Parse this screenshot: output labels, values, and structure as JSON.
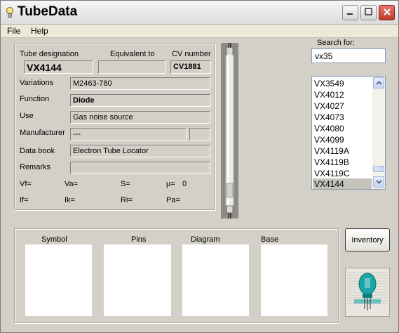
{
  "window": {
    "title": "TubeData"
  },
  "menu": {
    "file": "File",
    "help": "Help"
  },
  "details": {
    "tube_designation_label": "Tube designation",
    "tube_designation_value": "VX4144",
    "equivalent_label": "Equivalent to",
    "equivalent_value": "",
    "cv_label": "CV number",
    "cv_value": "CV1881",
    "variations_label": "Variations",
    "variations_value": "M2463-780",
    "function_label": "Function",
    "function_value": "Diode",
    "use_label": "Use",
    "use_value": "Gas noise source",
    "manufacturer_label": "Manufacturer",
    "manufacturer_value": "---",
    "manufacturer_extra": "",
    "databook_label": "Data book",
    "databook_value": "Electron Tube Locator",
    "remarks_label": "Remarks",
    "remarks_value": ""
  },
  "params": {
    "vf": "Vf=",
    "va": "Va=",
    "s": "S=",
    "mu": "µ=",
    "mu_value": "0",
    "if": "If=",
    "ik": "Ik=",
    "ri": "Ri=",
    "pa": "Pa="
  },
  "search": {
    "label": "Search for:",
    "value": "vx35"
  },
  "list": {
    "items": [
      "VX3549",
      "VX4012",
      "VX4027",
      "VX4073",
      "VX4080",
      "VX4099",
      "VX4119A",
      "VX4119B",
      "VX4119C",
      "VX4144"
    ],
    "selected_index": 9
  },
  "panels": {
    "symbol": "Symbol",
    "pins": "Pins",
    "diagram": "Diagram",
    "base": "Base"
  },
  "buttons": {
    "inventory": "Inventory"
  },
  "colors": {
    "window_bg": "#d4d0c8",
    "close_button": "#c13a27",
    "list_selection": "#c6c3bd",
    "logo_accent": "#1aa6a6"
  }
}
